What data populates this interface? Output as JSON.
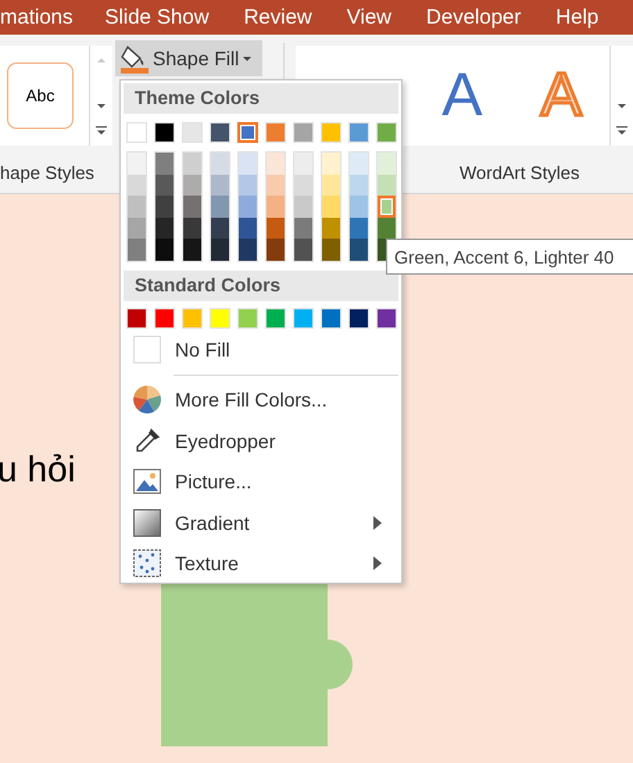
{
  "tabs": [
    {
      "label": "mations"
    },
    {
      "label": "Slide Show"
    },
    {
      "label": "Review"
    },
    {
      "label": "View"
    },
    {
      "label": "Developer"
    },
    {
      "label": "Help"
    }
  ],
  "ribbon": {
    "shape_style_sample": "Abc",
    "shape_styles_label": "hape Styles",
    "shape_fill_button": "Shape Fill",
    "wordart_samples": [
      {
        "letter": "A",
        "kind": "filled"
      },
      {
        "letter": "A",
        "kind": "outlined"
      }
    ],
    "wordart_label": "WordArt Styles"
  },
  "shape_fill_menu": {
    "theme_colors_heading": "Theme Colors",
    "theme_colors": [
      {
        "color": "#ffffff",
        "selected": false,
        "shades": [
          {
            "color": "#f2f2f2",
            "selected": false
          },
          {
            "color": "#d9d9d9",
            "selected": false
          },
          {
            "color": "#bfbfbf",
            "selected": false
          },
          {
            "color": "#a6a6a6",
            "selected": false
          },
          {
            "color": "#808080",
            "selected": false
          }
        ]
      },
      {
        "color": "#000000",
        "selected": false,
        "shades": [
          {
            "color": "#7f7f7f",
            "selected": false
          },
          {
            "color": "#595959",
            "selected": false
          },
          {
            "color": "#404040",
            "selected": false
          },
          {
            "color": "#262626",
            "selected": false
          },
          {
            "color": "#0d0d0d",
            "selected": false
          }
        ]
      },
      {
        "color": "#e7e6e6",
        "selected": false,
        "shades": [
          {
            "color": "#d0cece",
            "selected": false
          },
          {
            "color": "#aeabab",
            "selected": false
          },
          {
            "color": "#757171",
            "selected": false
          },
          {
            "color": "#3a3838",
            "selected": false
          },
          {
            "color": "#171616",
            "selected": false
          }
        ]
      },
      {
        "color": "#44546a",
        "selected": false,
        "shades": [
          {
            "color": "#d6dce5",
            "selected": false
          },
          {
            "color": "#adb9ca",
            "selected": false
          },
          {
            "color": "#8497b0",
            "selected": false
          },
          {
            "color": "#333f50",
            "selected": false
          },
          {
            "color": "#222a35",
            "selected": false
          }
        ]
      },
      {
        "color": "#4472c4",
        "selected": true,
        "shades": [
          {
            "color": "#dae3f3",
            "selected": false
          },
          {
            "color": "#b4c7e7",
            "selected": false
          },
          {
            "color": "#8faadc",
            "selected": false
          },
          {
            "color": "#2f5597",
            "selected": false
          },
          {
            "color": "#203864",
            "selected": false
          }
        ]
      },
      {
        "color": "#ed7d31",
        "selected": false,
        "shades": [
          {
            "color": "#fbe5d6",
            "selected": false
          },
          {
            "color": "#f8cbad",
            "selected": false
          },
          {
            "color": "#f4b183",
            "selected": false
          },
          {
            "color": "#c55a11",
            "selected": false
          },
          {
            "color": "#843c0c",
            "selected": false
          }
        ]
      },
      {
        "color": "#a5a5a5",
        "selected": false,
        "shades": [
          {
            "color": "#ededed",
            "selected": false
          },
          {
            "color": "#dbdbdb",
            "selected": false
          },
          {
            "color": "#c9c9c9",
            "selected": false
          },
          {
            "color": "#7b7b7b",
            "selected": false
          },
          {
            "color": "#525252",
            "selected": false
          }
        ]
      },
      {
        "color": "#ffc000",
        "selected": false,
        "shades": [
          {
            "color": "#fff2cc",
            "selected": false
          },
          {
            "color": "#ffe699",
            "selected": false
          },
          {
            "color": "#ffd966",
            "selected": false
          },
          {
            "color": "#bf9000",
            "selected": false
          },
          {
            "color": "#7f6000",
            "selected": false
          }
        ]
      },
      {
        "color": "#5b9bd5",
        "selected": false,
        "shades": [
          {
            "color": "#deebf7",
            "selected": false
          },
          {
            "color": "#bdd7ee",
            "selected": false
          },
          {
            "color": "#9dc3e6",
            "selected": false
          },
          {
            "color": "#2e75b6",
            "selected": false
          },
          {
            "color": "#1f4e79",
            "selected": false
          }
        ]
      },
      {
        "color": "#70ad47",
        "selected": false,
        "shades": [
          {
            "color": "#e2f0d9",
            "selected": false
          },
          {
            "color": "#c5e0b4",
            "selected": false
          },
          {
            "color": "#a9d18e",
            "selected": true
          },
          {
            "color": "#548235",
            "selected": false
          },
          {
            "color": "#385723",
            "selected": false
          }
        ]
      }
    ],
    "standard_colors_heading": "Standard Colors",
    "standard_colors": [
      {
        "color": "#c00000",
        "selected": false
      },
      {
        "color": "#ff0000",
        "selected": false
      },
      {
        "color": "#ffc000",
        "selected": false
      },
      {
        "color": "#ffff00",
        "selected": false
      },
      {
        "color": "#92d050",
        "selected": false
      },
      {
        "color": "#00b050",
        "selected": false
      },
      {
        "color": "#00b0f0",
        "selected": false
      },
      {
        "color": "#0070c0",
        "selected": false
      },
      {
        "color": "#002060",
        "selected": false
      },
      {
        "color": "#7030a0",
        "selected": false
      }
    ],
    "items": [
      {
        "kind": "no-fill",
        "label": "No Fill",
        "submenu": false
      },
      {
        "kind": "palette",
        "label": "More Fill Colors...",
        "submenu": false
      },
      {
        "kind": "eyedropper",
        "label": "Eyedropper",
        "submenu": false
      },
      {
        "kind": "picture",
        "label": "Picture...",
        "submenu": false
      },
      {
        "kind": "gradient",
        "label": "Gradient",
        "submenu": true
      },
      {
        "kind": "texture",
        "label": "Texture",
        "submenu": true
      }
    ]
  },
  "tooltip": "Green, Accent 6, Lighter 40",
  "slide": {
    "text": "u hỏi"
  }
}
